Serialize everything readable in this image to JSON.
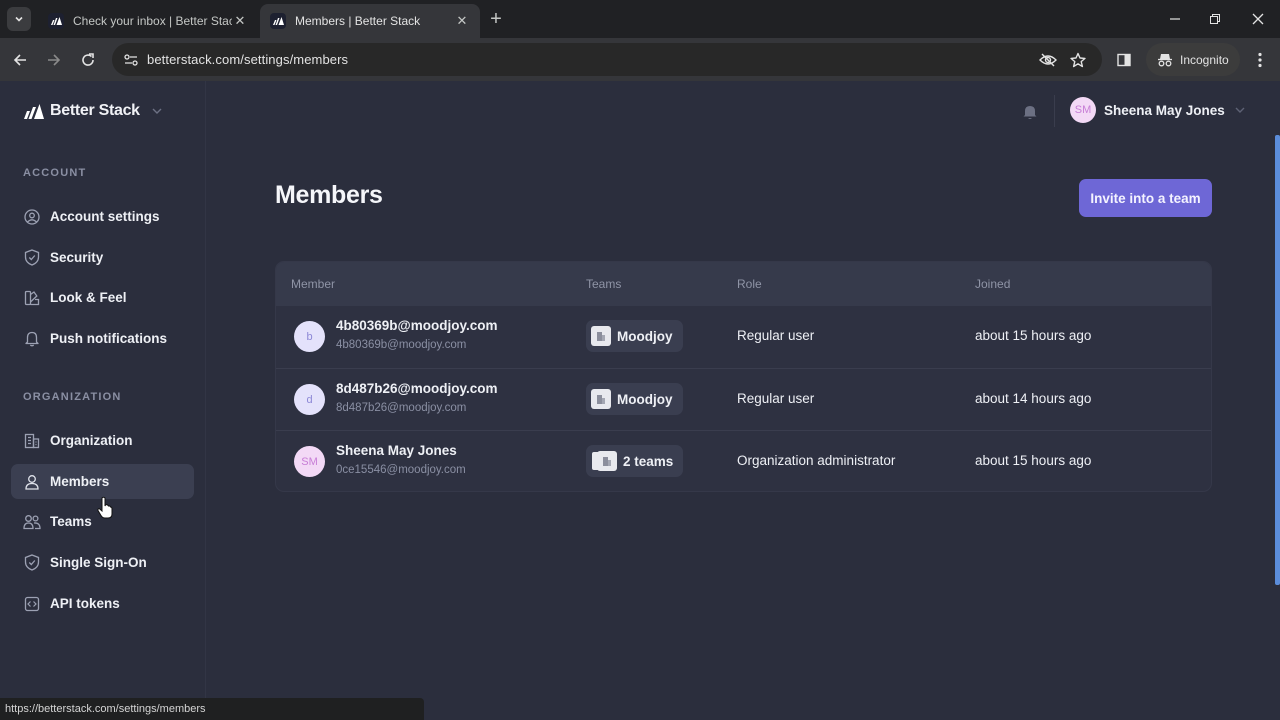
{
  "browser": {
    "tabs": [
      {
        "title": "Check your inbox | Better Stack",
        "active": false
      },
      {
        "title": "Members | Better Stack",
        "active": true
      }
    ],
    "url": "betterstack.com/settings/members",
    "profile_label": "Incognito",
    "status_url": "https://betterstack.com/settings/members"
  },
  "app": {
    "brand": "Better Stack",
    "sidebar": {
      "sections": [
        {
          "label": "ACCOUNT",
          "items": [
            {
              "label": "Account settings",
              "icon": "user-circle-icon"
            },
            {
              "label": "Security",
              "icon": "shield-check-icon"
            },
            {
              "label": "Look & Feel",
              "icon": "palette-icon"
            },
            {
              "label": "Push notifications",
              "icon": "bell-icon"
            }
          ]
        },
        {
          "label": "ORGANIZATION",
          "items": [
            {
              "label": "Organization",
              "icon": "building-icon"
            },
            {
              "label": "Members",
              "icon": "user-icon",
              "active": true
            },
            {
              "label": "Teams",
              "icon": "users-icon"
            },
            {
              "label": "Single Sign-On",
              "icon": "shield-check-icon"
            },
            {
              "label": "API tokens",
              "icon": "code-icon"
            }
          ]
        }
      ]
    },
    "user": {
      "initials": "SM",
      "name": "Sheena May Jones"
    },
    "page_title": "Members",
    "invite_button": "Invite into a team",
    "table": {
      "columns": [
        "Member",
        "Teams",
        "Role",
        "Joined"
      ],
      "rows": [
        {
          "initials": "b",
          "name": "4b80369b@moodjoy.com",
          "email": "4b80369b@moodjoy.com",
          "teams": "Moodjoy",
          "role": "Regular user",
          "joined": "about 15 hours ago"
        },
        {
          "initials": "d",
          "name": "8d487b26@moodjoy.com",
          "email": "8d487b26@moodjoy.com",
          "teams": "Moodjoy",
          "role": "Regular user",
          "joined": "about 14 hours ago"
        },
        {
          "initials": "SM",
          "name": "Sheena May Jones",
          "email": "0ce15546@moodjoy.com",
          "teams": "2 teams",
          "role": "Organization administrator",
          "joined": "about 15 hours ago"
        }
      ]
    }
  },
  "colors": {
    "accent": "#6e67d6",
    "background": "#2b2e3d",
    "table_header": "#363a4b"
  }
}
